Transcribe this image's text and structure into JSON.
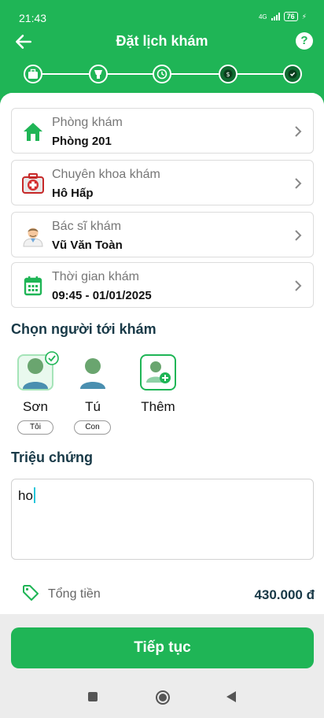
{
  "status_bar": {
    "time": "21:43",
    "network": "4G",
    "battery": "76"
  },
  "header": {
    "title": "Đặt lịch khám",
    "help_label": "?"
  },
  "stepper": {
    "steps": [
      "clinic",
      "specialty",
      "time",
      "payment",
      "confirm"
    ],
    "current_step": 3
  },
  "colors": {
    "primary": "#1fb556",
    "heading": "#183947",
    "badge_bg": "#e9f9ee"
  },
  "cards": [
    {
      "label": "Phòng khám",
      "value": "Phòng 201",
      "icon": "home-icon"
    },
    {
      "label": "Chuyên khoa khám",
      "value": "Hô Hấp",
      "icon": "medical-kit-icon"
    },
    {
      "label": "Bác sĩ khám",
      "value": "Vũ Văn Toàn",
      "icon": "doctor-icon"
    },
    {
      "label": "Thời gian khám",
      "value": "09:45 - 01/01/2025",
      "icon": "calendar-icon"
    }
  ],
  "patients": {
    "title": "Chọn người tới khám",
    "people": [
      {
        "name": "Sơn",
        "tag": "Tôi",
        "selected": true
      },
      {
        "name": "Tú",
        "tag": "Con",
        "selected": false
      }
    ],
    "add_label": "Thêm"
  },
  "symptoms": {
    "title": "Triệu chứng",
    "value": "ho"
  },
  "total": {
    "label": "Tổng tiền",
    "amount": "430.000 đ"
  },
  "cta": {
    "label": "Tiếp tục"
  }
}
